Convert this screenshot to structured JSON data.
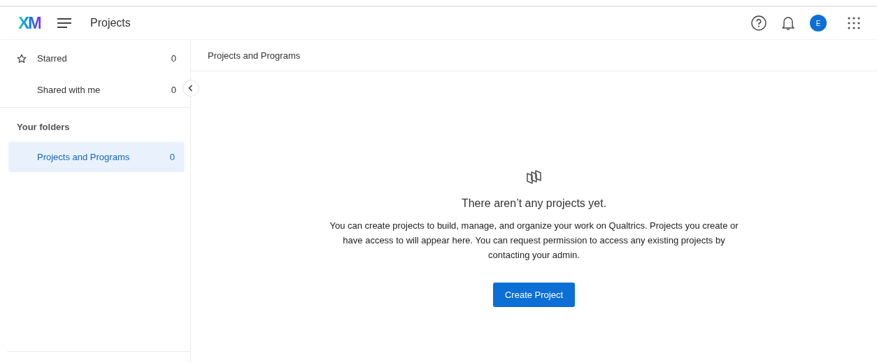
{
  "header": {
    "logo": "XM",
    "title": "Projects",
    "avatar": "E"
  },
  "sidebar": {
    "items": [
      {
        "kind": "starred",
        "label": "Starred",
        "count": "0",
        "selected": false
      },
      {
        "kind": "plain",
        "label": "Shared with me",
        "count": "0",
        "selected": false
      }
    ],
    "section_title": "Your folders",
    "folders": [
      {
        "label": "Projects and Programs",
        "count": "0",
        "selected": true
      }
    ]
  },
  "main": {
    "breadcrumb": "Projects and Programs",
    "empty_title": "There aren’t any projects yet.",
    "empty_text": "You can create projects to build, manage, and organize your work on Qualtrics. Projects you create or have access to will appear here. You can request permission to access any existing projects by contacting your admin.",
    "button": "Create Project"
  }
}
